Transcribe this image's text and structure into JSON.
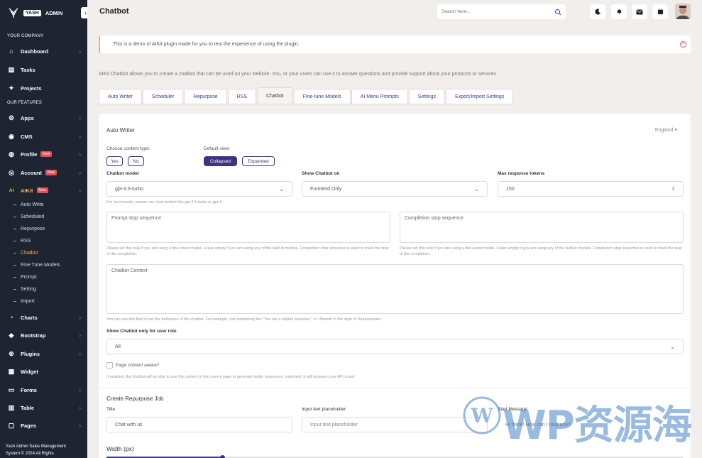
{
  "brand": {
    "box": "YASH",
    "name": "ADMIN"
  },
  "sidebar": {
    "section1": "YOUR COMPANY",
    "section2": "OUR FEATURES",
    "items": [
      {
        "label": "Dashboard",
        "icon": "home-icon",
        "chevron": true
      },
      {
        "label": "Tasks",
        "icon": "calendar-icon",
        "chevron": false
      },
      {
        "label": "Projects",
        "icon": "projects-icon",
        "chevron": false
      },
      {
        "label": "Apps",
        "icon": "apps-icon",
        "chevron": true
      },
      {
        "label": "CMS",
        "icon": "cms-icon",
        "chevron": true
      },
      {
        "label": "Profile",
        "icon": "profile-icon",
        "chevron": true,
        "badge": "New"
      },
      {
        "label": "Account",
        "icon": "account-icon",
        "chevron": true,
        "badge": "New"
      },
      {
        "label": "AIKit",
        "icon": "ai-icon",
        "chevron": true,
        "badge": "New",
        "active": true
      },
      {
        "label": "Charts",
        "icon": "chart-icon",
        "chevron": true
      },
      {
        "label": "Bootstrap",
        "icon": "bootstrap-icon",
        "chevron": true
      },
      {
        "label": "Plugins",
        "icon": "plugins-icon",
        "chevron": true
      },
      {
        "label": "Widget",
        "icon": "widget-icon",
        "chevron": false
      },
      {
        "label": "Forms",
        "icon": "forms-icon",
        "chevron": true
      },
      {
        "label": "Table",
        "icon": "table-icon",
        "chevron": true
      },
      {
        "label": "Pages",
        "icon": "pages-icon",
        "chevron": true
      }
    ],
    "aikit_sub": [
      "Auto Write",
      "Scheduled",
      "Repurpose",
      "RSS",
      "Chatbot",
      "Fine Tune Models",
      "Prompt",
      "Setting",
      "Import"
    ],
    "footer_line1": "Yash Admin Sales Management",
    "footer_line2": "System © 2024 All Rights"
  },
  "header": {
    "title": "Chatbot",
    "search_placeholder": "Search here..."
  },
  "alert": "This is a demo of AIKit plugin made for you to test the experience of using the plugin.",
  "intro": "AIKit Chatbot allows you to create a chatbot that can be used on your website. You, or your users can use it to answer questions and provide support about your products or services.",
  "tabs": [
    "Auto Writer",
    "Scheduler",
    "Repurpose",
    "RSS",
    "Chatbot",
    "Fine-tune Models",
    "AI Menu Prompts",
    "Settings",
    "Export/Import Settings"
  ],
  "active_tab": "Chatbot",
  "card": {
    "title": "Auto Writer",
    "language": "England",
    "content_type_label": "Choose content type:",
    "yes": "Yes",
    "no": "No",
    "default_view_label": "Default view:",
    "collapsed": "Collapsed",
    "expanded": "Expanded",
    "model_label": "Chatbot model",
    "model_value": "gpt-3.5-turbo",
    "model_hint": "For best results, please use chat models like gpt-3.5-turbo or gpt-4.",
    "show_on_label": "Show Chatbot on",
    "show_on_value": "Frontend Only",
    "max_tokens_label": "Max response tokens",
    "max_tokens_value": "150",
    "prompt_stop_placeholder": "Prompt stop sequence",
    "prompt_stop_hint": "Please set this only if you are using a fine-tuned model. Leave empty if you are using any of the built-in models. Completion stop sequence is used to mark the stop of the completion.",
    "completion_stop_placeholder": "Completion stop sequence",
    "completion_stop_hint": "Please set this only if you are using a fine-tuned model. Leave empty if you are using any of the built-in models. Completion stop sequence is used to mark the stop of the completion.",
    "context_placeholder": "Chatbot Context",
    "context_hint": "You can use this field to set the behaviour of the chatbot. For example, use something like \"You are a helpful assistant.\" or \"Answer in the style of Shakespeare.\"",
    "role_label": "Show Chatbot only for user role",
    "role_value": "All",
    "page_aware_label": "Page content aware?",
    "page_aware_hint": "If enabled, the chatbot will be able to use the content of the current page to generate better responses. Important: it will increase your API costs!",
    "repurpose_title": "Create Repurpose Job",
    "title_label": "Title",
    "title_placeholder": "Chat with us",
    "input_ph_label": "Input text placeholder",
    "input_ph_placeholder": "Input text placeholder",
    "start_msg_label": "Start Message",
    "start_msg_placeholder": "Hi there! How can I help you?",
    "width_label": "Width (px)",
    "width_fraction": 0.2
  },
  "watermark": "WP资源海",
  "colors": {
    "sidebar": "#1f2433",
    "accent": "#3b3480",
    "active": "#f4b942",
    "badge": "#e8515b"
  }
}
